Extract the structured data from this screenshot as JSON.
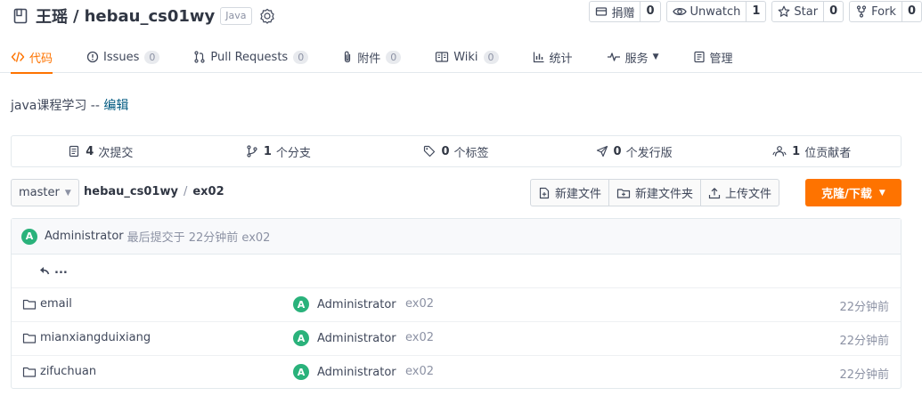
{
  "repo": {
    "owner": "王瑶",
    "separator": "/",
    "name": "hebau_cs01wy",
    "language": "Java"
  },
  "actions": [
    {
      "label": "捐赠",
      "count": "0",
      "icon": "donate-icon"
    },
    {
      "label": "Unwatch",
      "count": "1",
      "icon": "eye-icon"
    },
    {
      "label": "Star",
      "count": "0",
      "icon": "star-icon"
    },
    {
      "label": "Fork",
      "count": "0",
      "icon": "fork-icon"
    }
  ],
  "tabs": [
    {
      "label": "代码",
      "icon": "code-icon",
      "active": true
    },
    {
      "label": "Issues",
      "count": "0",
      "icon": "issues-icon"
    },
    {
      "label": "Pull Requests",
      "count": "0",
      "icon": "pull-request-icon"
    },
    {
      "label": "附件",
      "count": "0",
      "icon": "paperclip-icon"
    },
    {
      "label": "Wiki",
      "count": "0",
      "icon": "wiki-icon"
    },
    {
      "label": "统计",
      "icon": "chart-icon"
    },
    {
      "label": "服务",
      "icon": "pulse-icon",
      "dropdown": true
    },
    {
      "label": "管理",
      "icon": "settings-doc-icon"
    }
  ],
  "description": {
    "text": "java课程学习",
    "separator": " -- ",
    "edit_label": "编辑"
  },
  "stats": [
    {
      "count": "4",
      "label": "次提交",
      "icon": "commit-icon"
    },
    {
      "count": "1",
      "label": "个分支",
      "icon": "branch-icon"
    },
    {
      "count": "0",
      "label": "个标签",
      "icon": "tag-icon"
    },
    {
      "count": "0",
      "label": "个发行版",
      "icon": "release-icon"
    },
    {
      "count": "1",
      "label": "位贡献者",
      "icon": "contributors-icon"
    }
  ],
  "toolbar": {
    "branch": "master",
    "path_root": "hebau_cs01wy",
    "path_sep": "/",
    "path_current": "ex02",
    "new_file": "新建文件",
    "new_folder": "新建文件夹",
    "upload": "上传文件",
    "clone": "克隆/下载"
  },
  "last_commit": {
    "avatar": "A",
    "author": "Administrator",
    "meta": "最后提交于 22分钟前 ex02"
  },
  "back_label": "...",
  "files": [
    {
      "name": "email",
      "avatar": "A",
      "author": "Administrator",
      "message": "ex02",
      "time": "22分钟前"
    },
    {
      "name": "mianxiangduixiang",
      "avatar": "A",
      "author": "Administrator",
      "message": "ex02",
      "time": "22分钟前"
    },
    {
      "name": "zifuchuan",
      "avatar": "A",
      "author": "Administrator",
      "message": "ex02",
      "time": "22分钟前"
    }
  ],
  "colors": {
    "accent": "#fe7300",
    "avatar": "#2ab27b",
    "link": "#005980"
  }
}
